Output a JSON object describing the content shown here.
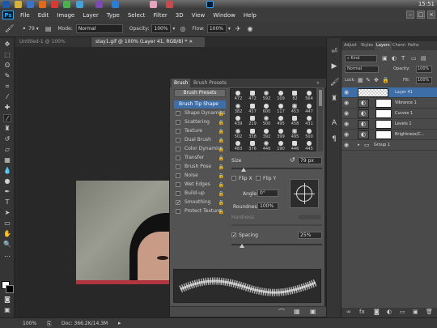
{
  "taskbar": {
    "clock": "15:51"
  },
  "app": {
    "logo": "Ps"
  },
  "menu": [
    "File",
    "Edit",
    "Image",
    "Layer",
    "Type",
    "Select",
    "Filter",
    "3D",
    "View",
    "Window",
    "Help"
  ],
  "window_controls": {
    "minimize": "–",
    "restore": "□",
    "close": "×"
  },
  "options": {
    "brush_size": "79",
    "mode_label": "Mode:",
    "mode_value": "Normal",
    "opacity_label": "Opacity:",
    "opacity_value": "100%",
    "flow_label": "Flow:",
    "flow_value": "100%"
  },
  "doc_tabs": [
    {
      "label": "Untitled-1 @ 100% (RGB/8)",
      "close": "×"
    },
    {
      "label": "stay1.gif @ 100% (Layer 41, RGB/8) *",
      "close": "×"
    }
  ],
  "brush_panel": {
    "tabs": [
      "Brush",
      "Brush Presets"
    ],
    "collapse": "»",
    "presets_button": "Brush Presets",
    "options": [
      {
        "label": "Brush Tip Shape",
        "checkbox": false,
        "lock": false,
        "selected": true,
        "checked": false
      },
      {
        "label": "Shape Dynamics",
        "checkbox": true,
        "lock": true,
        "checked": false
      },
      {
        "label": "Scattering",
        "checkbox": true,
        "lock": true,
        "checked": false
      },
      {
        "label": "Texture",
        "checkbox": true,
        "lock": true,
        "checked": false
      },
      {
        "label": "Dual Brush",
        "checkbox": true,
        "lock": true,
        "checked": false
      },
      {
        "label": "Color Dynamics",
        "checkbox": true,
        "lock": true,
        "checked": false
      },
      {
        "label": "Transfer",
        "checkbox": true,
        "lock": true,
        "checked": false
      },
      {
        "label": "Brush Pose",
        "checkbox": true,
        "lock": true,
        "checked": false
      },
      {
        "label": "Noise",
        "checkbox": true,
        "lock": true,
        "checked": false
      },
      {
        "label": "Wet Edges",
        "checkbox": true,
        "lock": true,
        "checked": false
      },
      {
        "label": "Build-up",
        "checkbox": true,
        "lock": true,
        "checked": false
      },
      {
        "label": "Smoothing",
        "checkbox": true,
        "lock": true,
        "checked": true
      },
      {
        "label": "Protect Texture",
        "checkbox": true,
        "lock": true,
        "checked": false
      }
    ],
    "brush_sizes": [
      "472",
      "472",
      "592",
      "109",
      "82",
      "564",
      "382",
      "457",
      "600",
      "117",
      "453",
      "447",
      "439",
      "219",
      "500",
      "495",
      "458",
      "431",
      "502",
      "358",
      "392",
      "399",
      "495",
      "500",
      "483",
      "376",
      "446",
      "190",
      "446",
      "445"
    ],
    "size_label": "Size",
    "size_value": "79 px",
    "flip_x": "Flip X",
    "flip_y": "Flip Y",
    "angle_label": "Angle:",
    "angle_value": "0°",
    "roundness_label": "Roundness:",
    "roundness_value": "100%",
    "hardness_label": "Hardness",
    "spacing_label": "Spacing",
    "spacing_value": "25%",
    "spacing_checked": true
  },
  "layers_panel": {
    "tabs": [
      "Adjust",
      "Styles",
      "Layers",
      "Chann",
      "Paths"
    ],
    "kind_label": "Kind",
    "blend_mode": "Normal",
    "opacity_label": "Opacity:",
    "opacity_value": "100%",
    "lock_label": "Lock:",
    "fill_label": "Fill:",
    "fill_value": "100%",
    "layers": [
      {
        "name": "Layer 41",
        "adjustment": false,
        "selected": true
      },
      {
        "name": "Vibrance 1",
        "adjustment": true
      },
      {
        "name": "Curves 1",
        "adjustment": true
      },
      {
        "name": "Levels 1",
        "adjustment": true
      },
      {
        "name": "Brightness/C...",
        "adjustment": true
      },
      {
        "name": "Group 1",
        "group": true
      }
    ]
  },
  "status": {
    "zoom": "100%",
    "doc_info": "Doc: 366.2K/14.3M"
  }
}
